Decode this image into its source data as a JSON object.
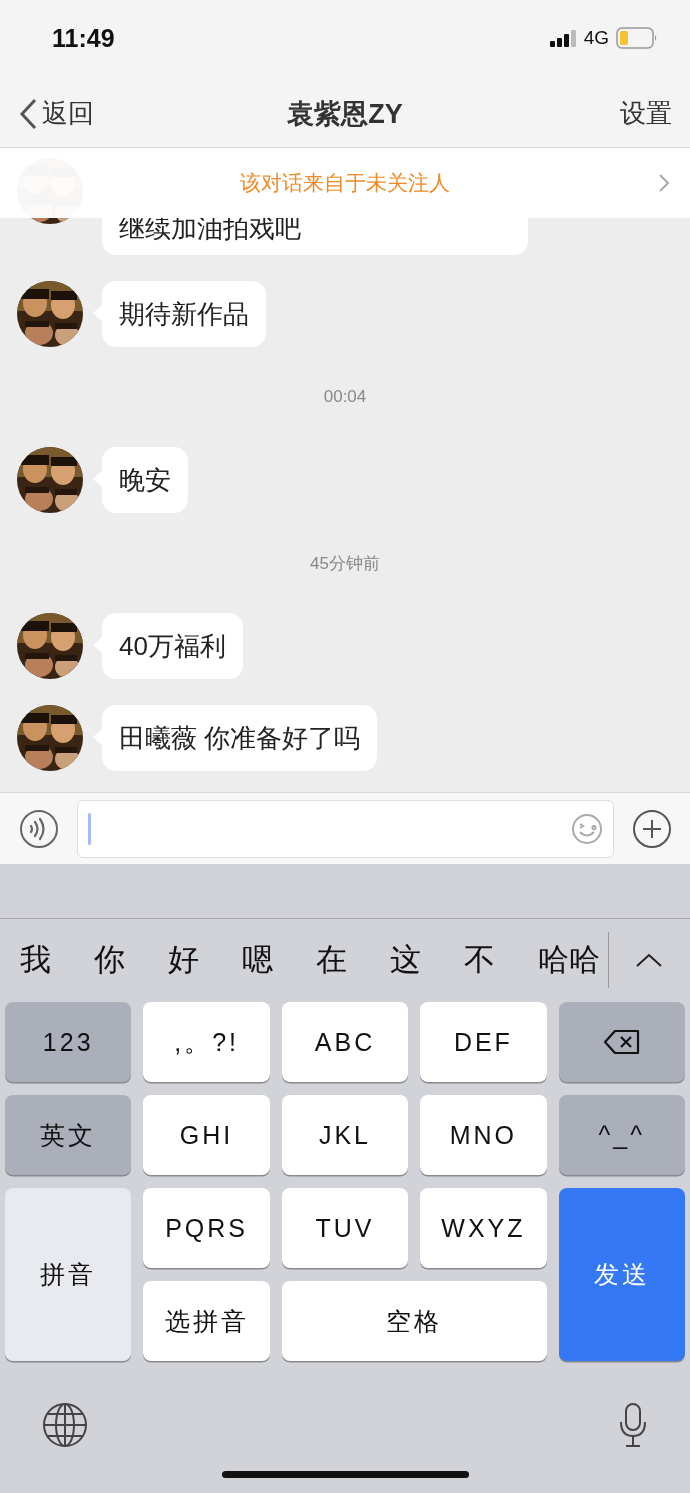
{
  "status_bar": {
    "time": "11:49",
    "network": "4G"
  },
  "nav": {
    "back": "返回",
    "title": "袁紫恩ZY",
    "settings": "设置"
  },
  "banner": {
    "text": "该对话来自于未关注人"
  },
  "messages": [
    {
      "kind": "partial",
      "text": "继续加油拍戏吧"
    },
    {
      "kind": "message",
      "text": "期待新作品"
    },
    {
      "kind": "time",
      "text": "00:04"
    },
    {
      "kind": "message",
      "text": "晚安"
    },
    {
      "kind": "time",
      "text": "45分钟前"
    },
    {
      "kind": "message",
      "text": "40万福利"
    },
    {
      "kind": "message",
      "text": "田曦薇 你准备好了吗"
    }
  ],
  "keyboard": {
    "candidates": [
      "我",
      "你",
      "好",
      "嗯",
      "在",
      "这",
      "不",
      "哈哈"
    ],
    "keys": [
      {
        "kind": "function",
        "label": "123"
      },
      {
        "kind": "letter",
        "label": ",。?!"
      },
      {
        "kind": "letter",
        "label": "ABC"
      },
      {
        "kind": "letter",
        "label": "DEF"
      },
      {
        "kind": "delete"
      },
      {
        "kind": "function",
        "label": "英文"
      },
      {
        "kind": "letter",
        "label": "GHI"
      },
      {
        "kind": "letter",
        "label": "JKL"
      },
      {
        "kind": "letter",
        "label": "MNO"
      },
      {
        "kind": "function",
        "label": "^_^"
      },
      {
        "kind": "mode",
        "label": "拼音"
      },
      {
        "kind": "letter",
        "label": "PQRS"
      },
      {
        "kind": "letter",
        "label": "TUV"
      },
      {
        "kind": "letter",
        "label": "WXYZ"
      },
      {
        "kind": "send",
        "label": "发送"
      },
      {
        "kind": "letter",
        "label": "选拼音"
      },
      {
        "kind": "space",
        "label": "空格"
      }
    ]
  }
}
